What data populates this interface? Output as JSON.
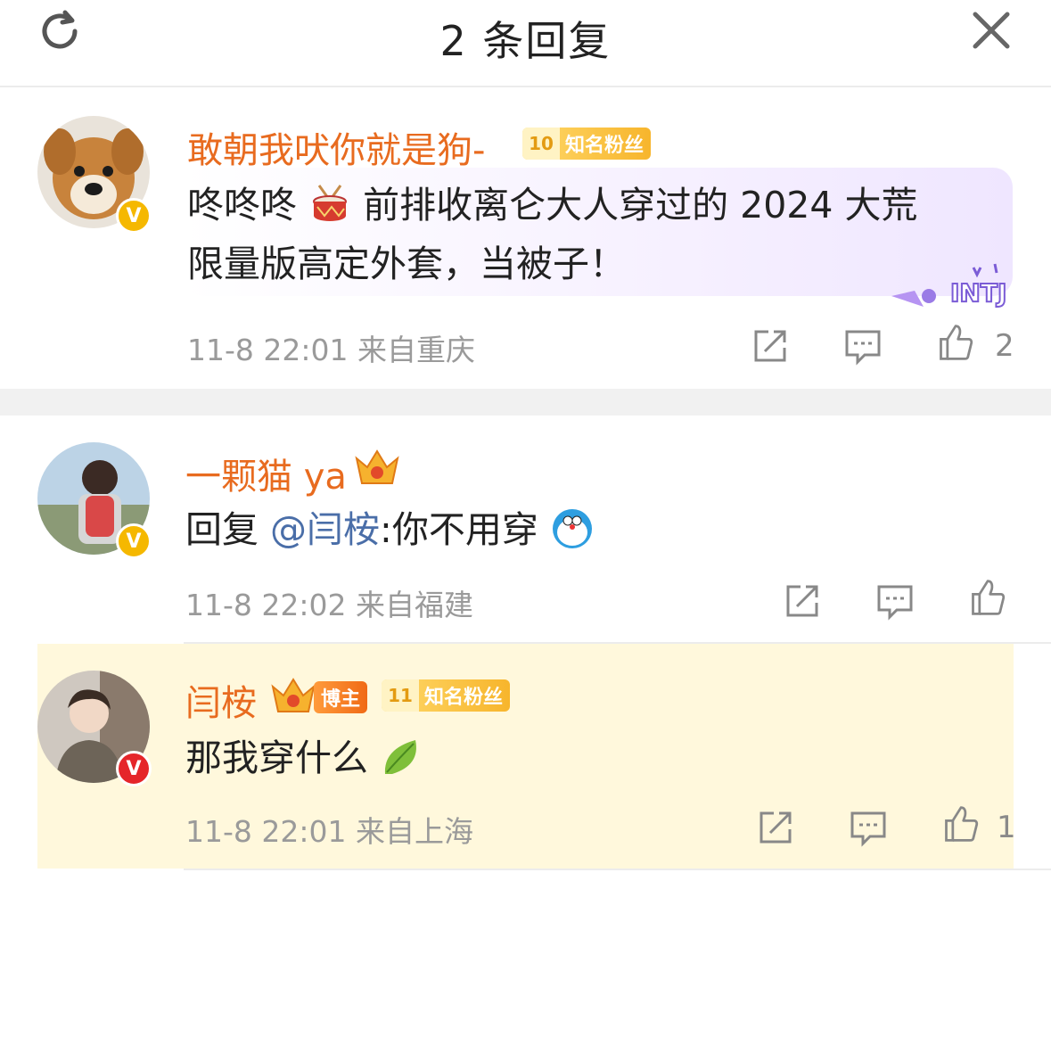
{
  "header": {
    "title": "2 条回复"
  },
  "main_comment": {
    "username": "敢朝我吠你就是狗-",
    "fan_badge": {
      "level": "10",
      "label": "知名粉丝"
    },
    "text_line1_prefix": "咚咚咚",
    "text_line1_suffix": "前排收离仑大人穿过的 2024 大荒",
    "text_line2": "限量版高定外套，当被子！",
    "tag_label": "INTJ",
    "timestamp": "11-8 22:01",
    "location": "来自重庆",
    "like_count": "2",
    "colors": {
      "username": "#e86b1f",
      "bubble_tint": "#efe6ff",
      "tag": "#7b5cd6"
    }
  },
  "reply1": {
    "username": "一颗猫 ya",
    "reply_prefix": "回复",
    "mention": "@闫桉",
    "text": ":你不用穿",
    "timestamp": "11-8 22:02",
    "location": "来自福建",
    "colors": {
      "mention": "#4a6ea8"
    }
  },
  "reply2": {
    "username": "闫桉",
    "blogger_badge": "博主",
    "fan_badge": {
      "level": "11",
      "label": "知名粉丝"
    },
    "text": "那我穿什么",
    "timestamp": "11-8 22:01",
    "location": "来自上海",
    "like_count": "1",
    "colors": {
      "highlight_bg": "#fff8dc"
    }
  }
}
